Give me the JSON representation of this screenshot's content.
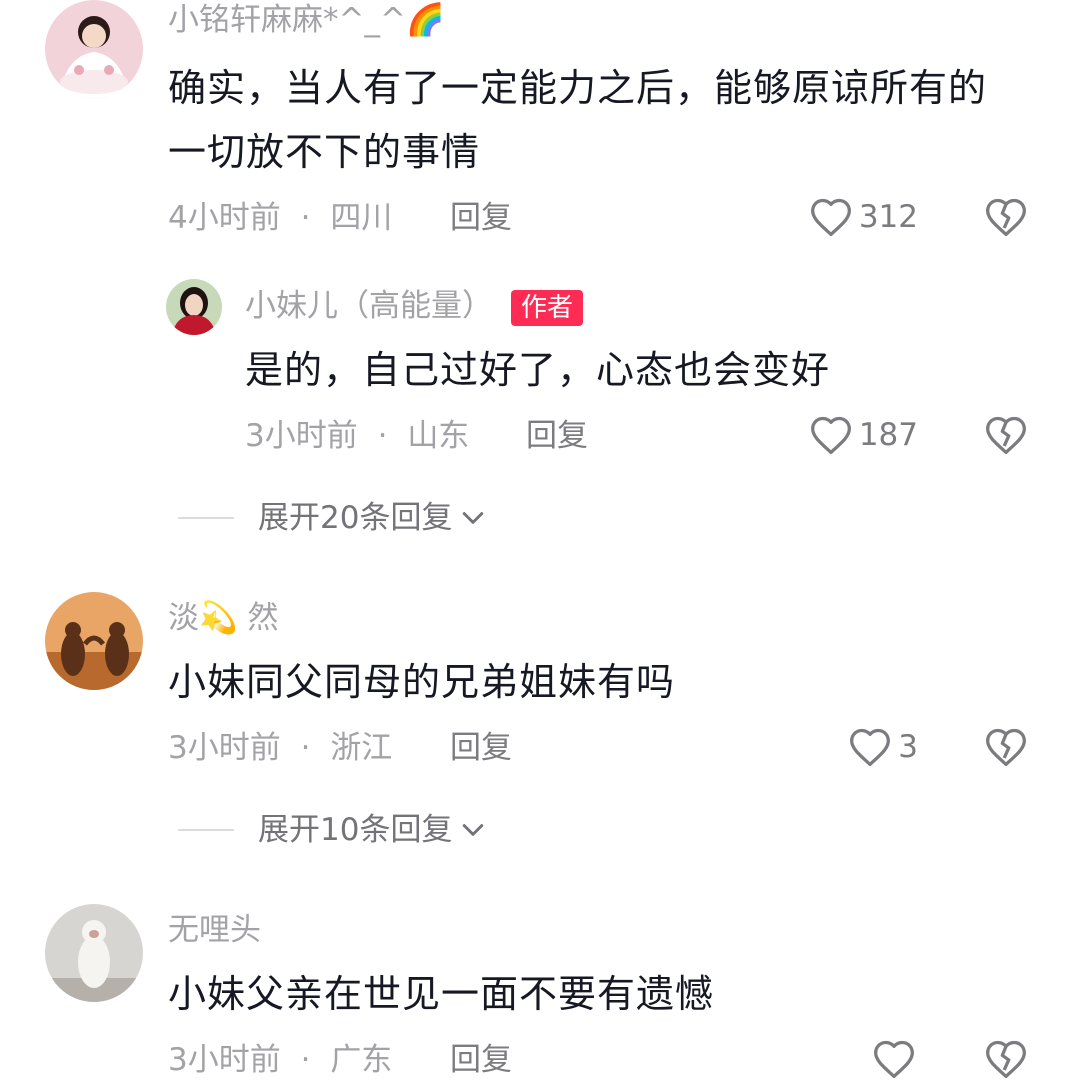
{
  "comments": [
    {
      "username": "小铭轩麻麻*^_^🌈",
      "text_line1": "确实，当人有了一定能力之后，能够原谅所有的",
      "text_line2": "一切放不下的事情",
      "time": "4小时前",
      "location": "四川",
      "reply_label": "回复",
      "likes": "312",
      "reply": {
        "username": "小妹儿（高能量）",
        "badge": "作者",
        "text": "是的，自己过好了，心态也会变好",
        "time": "3小时前",
        "location": "山东",
        "reply_label": "回复",
        "likes": "187"
      },
      "expand_label": "展开20条回复"
    },
    {
      "username": "淡💫 然",
      "text": "小妹同父同母的兄弟姐妹有吗",
      "time": "3小时前",
      "location": "浙江",
      "reply_label": "回复",
      "likes": "3",
      "expand_label": "展开10条回复"
    },
    {
      "username": "无哩头",
      "text": "小妹父亲在世见一面不要有遗憾",
      "time": "3小时前",
      "location": "广东",
      "reply_label": "回复",
      "likes": ""
    }
  ],
  "separator": "·",
  "icons": {
    "like": "heart-outline-icon",
    "dislike": "broken-heart-icon",
    "expand": "chevron-down-icon"
  },
  "colors": {
    "badge": "#fe2c55",
    "muted": "#a3a3a7",
    "text": "#161823"
  }
}
